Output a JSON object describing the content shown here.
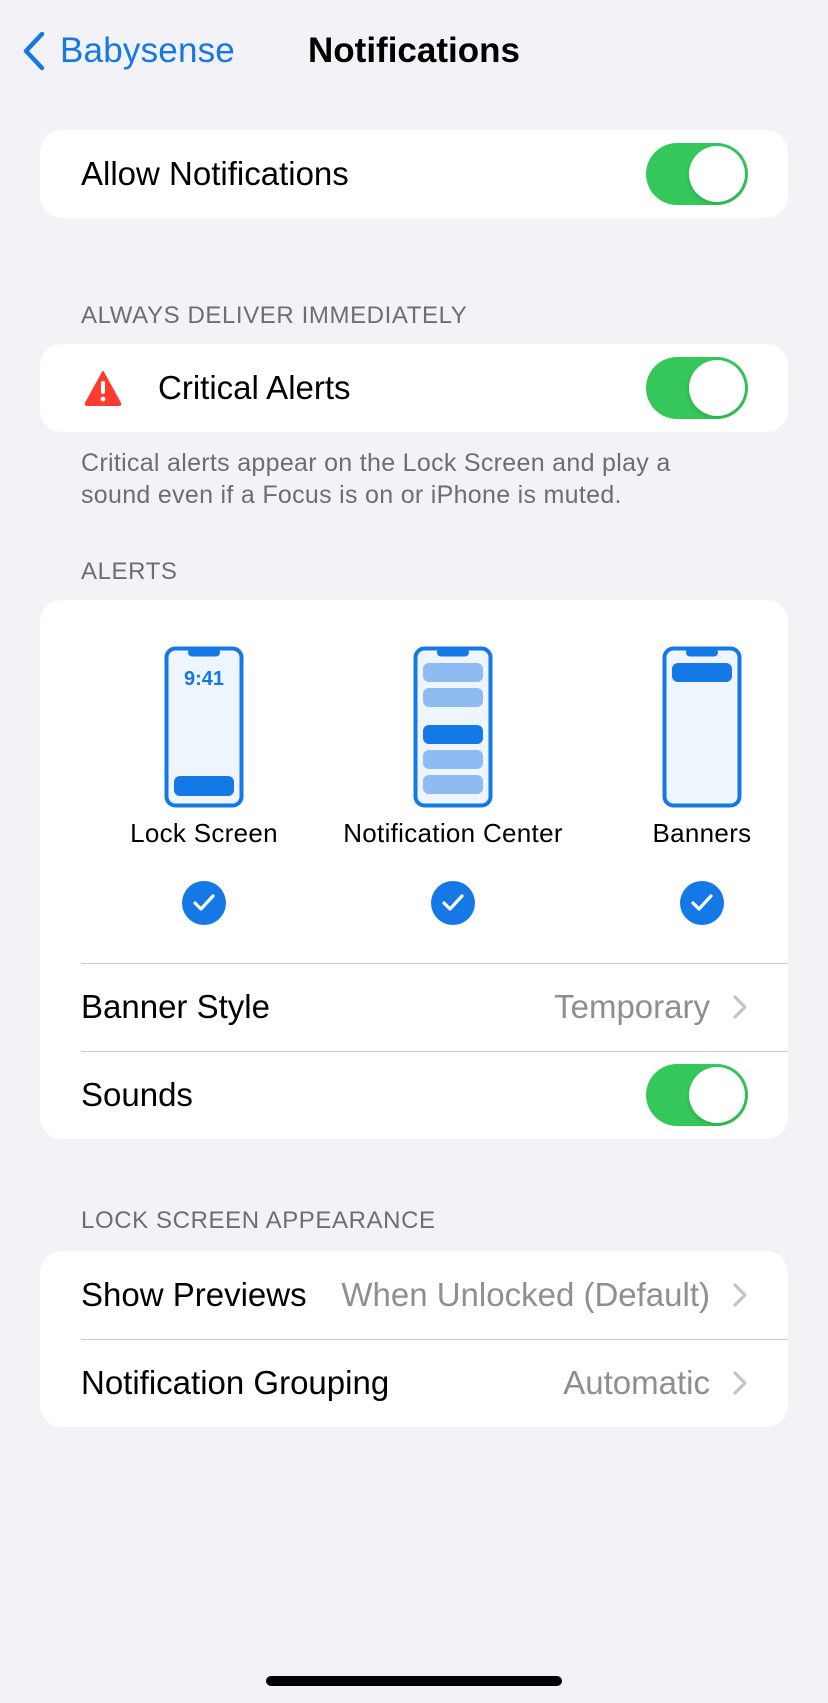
{
  "nav": {
    "back_label": "Babysense",
    "title": "Notifications"
  },
  "allow_notifications": {
    "label": "Allow Notifications",
    "enabled": true
  },
  "always_deliver": {
    "header": "ALWAYS DELIVER IMMEDIATELY",
    "critical_alerts_label": "Critical Alerts",
    "critical_alerts_icon": "warning-triangle-icon",
    "critical_alerts_enabled": true,
    "footer": "Critical alerts appear on the Lock Screen and play a sound even if a Focus is on or iPhone is muted."
  },
  "alerts": {
    "header": "ALERTS",
    "options": [
      {
        "label": "Lock Screen",
        "checked": true,
        "clock": "9:41"
      },
      {
        "label": "Notification Center",
        "checked": true
      },
      {
        "label": "Banners",
        "checked": true
      }
    ],
    "banner_style_label": "Banner Style",
    "banner_style_value": "Temporary",
    "sounds_label": "Sounds",
    "sounds_enabled": true
  },
  "lock_screen_appearance": {
    "header": "LOCK SCREEN APPEARANCE",
    "show_previews_label": "Show Previews",
    "show_previews_value": "When Unlocked (Default)",
    "grouping_label": "Notification Grouping",
    "grouping_value": "Automatic"
  },
  "colors": {
    "accent": "#1478e6",
    "toggle_on": "#34c759",
    "background": "#f2f2f7",
    "critical_red": "#ff3b30"
  }
}
